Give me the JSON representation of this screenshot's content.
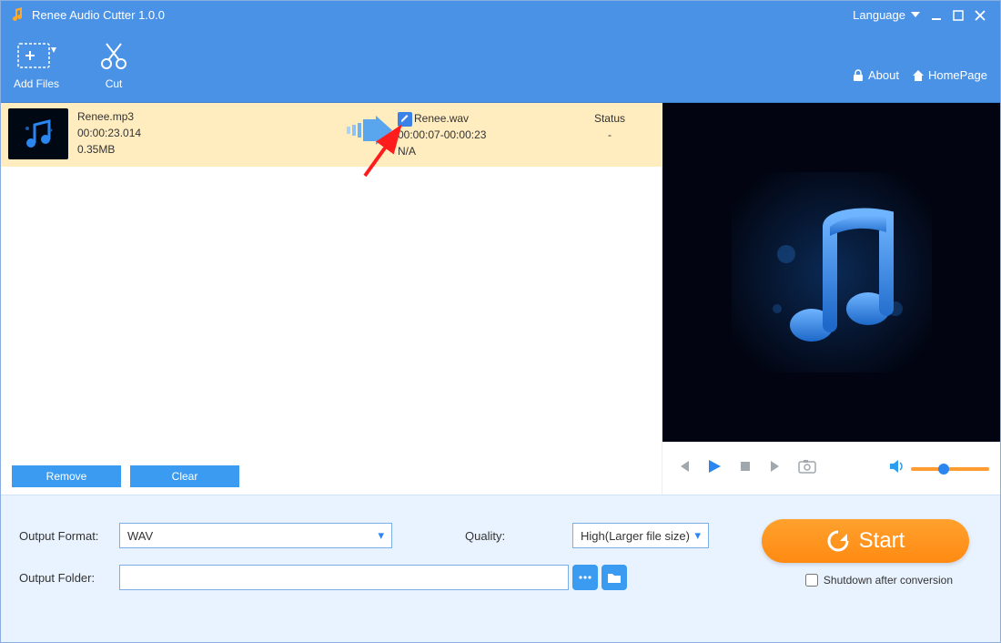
{
  "title": "Renee Audio Cutter 1.0.0",
  "titlebar": {
    "language_label": "Language"
  },
  "toolbar": {
    "add_files": "Add Files",
    "cut": "Cut",
    "about": "About",
    "homepage": "HomePage"
  },
  "filelist": {
    "rows": [
      {
        "src_name": "Renee.mp3",
        "src_duration": "00:00:23.014",
        "src_size": "0.35MB",
        "out_name": "Renee.wav",
        "out_range": "00:00:07-00:00:23",
        "out_extra": "N/A",
        "status_label": "Status",
        "status_value": "-"
      }
    ],
    "remove_btn": "Remove",
    "clear_btn": "Clear"
  },
  "bottom": {
    "output_format_label": "Output Format:",
    "output_format_value": "WAV",
    "quality_label": "Quality:",
    "quality_value": "High(Larger file size)",
    "output_folder_label": "Output Folder:",
    "output_folder_value": "",
    "start_label": "Start",
    "shutdown_label": "Shutdown after conversion"
  }
}
